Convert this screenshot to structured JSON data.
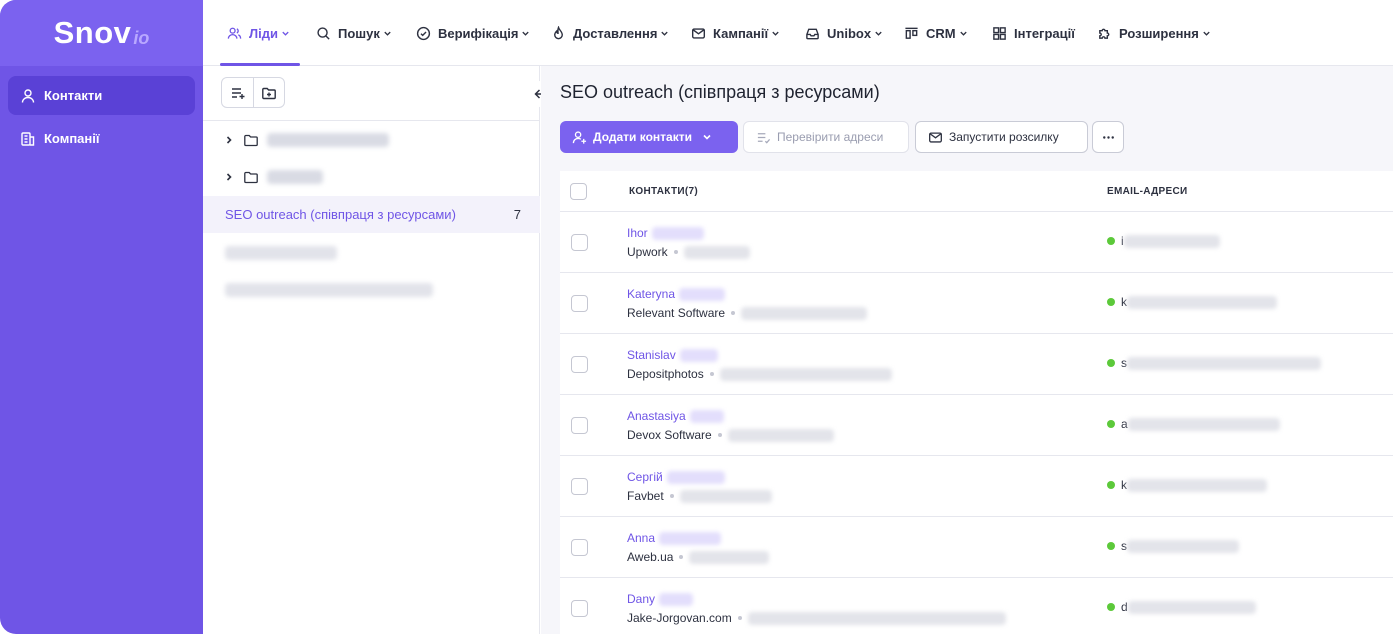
{
  "logo": {
    "main": "Snov",
    "sub": "io"
  },
  "sidebar": {
    "items": [
      {
        "label": "Контакти",
        "icon": "user-icon",
        "active": true
      },
      {
        "label": "Компанії",
        "icon": "building-icon",
        "active": false
      }
    ]
  },
  "nav": {
    "items": [
      {
        "label": "Ліди",
        "icon": "users-icon",
        "active": true
      },
      {
        "label": "Пошук",
        "icon": "search-icon"
      },
      {
        "label": "Верифікація",
        "icon": "check-circle-icon"
      },
      {
        "label": "Доставлення",
        "icon": "flame-icon"
      },
      {
        "label": "Кампанії",
        "icon": "mail-icon"
      },
      {
        "label": "Unibox",
        "icon": "inbox-icon"
      },
      {
        "label": "CRM",
        "icon": "crm-icon"
      },
      {
        "label": "Інтеграції",
        "icon": "grid-icon"
      },
      {
        "label": "Розширення",
        "icon": "puzzle-icon"
      }
    ]
  },
  "lists": {
    "selected": {
      "name": "SEO outreach (співпраця з ресурсами)",
      "count": "7"
    }
  },
  "main": {
    "title": "SEO outreach (співпраця з ресурсами)",
    "add_contacts": "Додати контакти",
    "verify": "Перевірити адреси",
    "launch": "Запустити розсилку"
  },
  "table": {
    "col_contacts": "КОНТАКТИ(7)",
    "col_emails": "EMAIL-АДРЕСИ",
    "rows": [
      {
        "name": "Ihor",
        "company": "Upwork",
        "email_initial": "i"
      },
      {
        "name": "Kateryna",
        "company": "Relevant Software",
        "email_initial": "k"
      },
      {
        "name": "Stanislav",
        "company": "Depositphotos",
        "email_initial": "s"
      },
      {
        "name": "Anastasiya",
        "company": "Devox Software",
        "email_initial": "a"
      },
      {
        "name": "Сергій",
        "company": "Favbet",
        "email_initial": "k"
      },
      {
        "name": "Anna",
        "company": "Aweb.ua",
        "email_initial": "s"
      },
      {
        "name": "Dany",
        "company": "Jake-Jorgovan.com",
        "email_initial": "d"
      }
    ]
  },
  "colors": {
    "accent": "#6f55e6",
    "sidebar": "#6f55e6",
    "email_ok": "#5cc93a"
  }
}
